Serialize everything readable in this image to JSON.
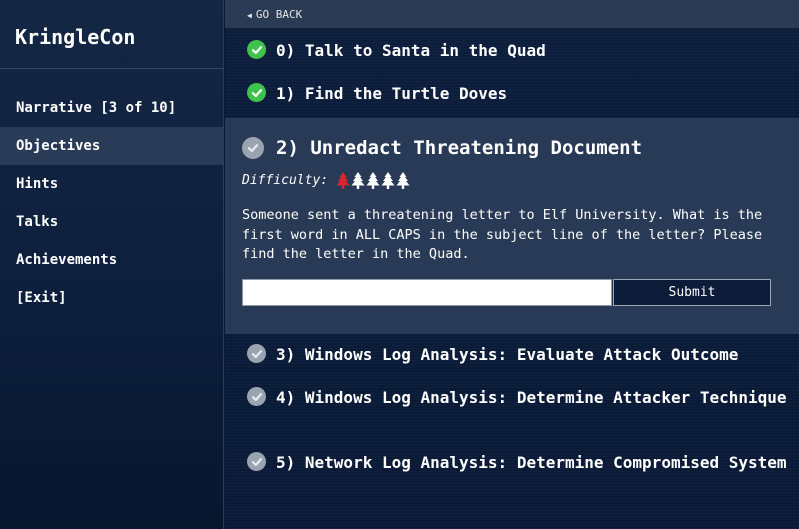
{
  "sidebar": {
    "brand": "KringleCon",
    "items": [
      {
        "label": "Narrative [3 of 10]",
        "active": false
      },
      {
        "label": "Objectives",
        "active": true
      },
      {
        "label": "Hints",
        "active": false
      },
      {
        "label": "Talks",
        "active": false
      },
      {
        "label": "Achievements",
        "active": false
      },
      {
        "label": "[Exit]",
        "active": false
      }
    ]
  },
  "main": {
    "go_back_label": "GO BACK",
    "objectives": [
      {
        "title": "0) Talk to Santa in the Quad",
        "status": "complete"
      },
      {
        "title": "1) Find the Turtle Doves",
        "status": "complete"
      },
      {
        "title": "2) Unredact Threatening Document",
        "status": "incomplete"
      },
      {
        "title": "3) Windows Log Analysis: Evaluate Attack Outcome",
        "status": "incomplete"
      },
      {
        "title": "4) Windows Log Analysis: Determine Attacker Technique",
        "status": "incomplete"
      },
      {
        "title": "5) Network Log Analysis: Determine Compromised System",
        "status": "incomplete"
      }
    ],
    "active_objective": {
      "difficulty_label": "Difficulty:",
      "difficulty_level": 1,
      "difficulty_max": 5,
      "description": "Someone sent a threatening letter to Elf University. What is the first word in ALL CAPS in the subject line of the letter? Please find the letter in the Quad.",
      "answer_value": "",
      "submit_label": "Submit"
    }
  },
  "colors": {
    "complete": "#3fc24e",
    "incomplete": "#9aa3b0",
    "difficulty_on": "#d8262e",
    "difficulty_off": "#ffffff"
  }
}
